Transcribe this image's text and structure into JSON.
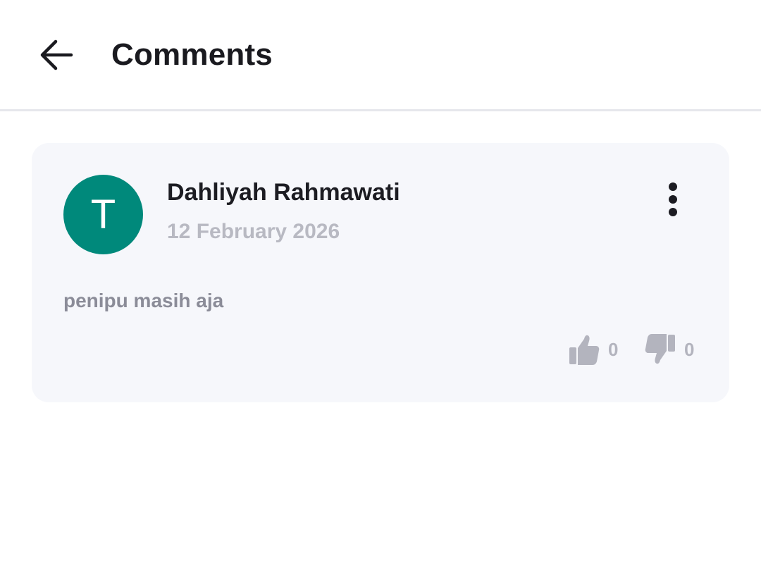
{
  "header": {
    "back_icon": "arrow-left-icon",
    "title": "Comments"
  },
  "comment": {
    "avatar_initial": "T",
    "avatar_color": "#00897b",
    "author": "Dahliyah Rahmawati",
    "date": "12 February 2026",
    "more_icon": "vertical-dots-icon",
    "text": "penipu masih aja",
    "likes": "0",
    "dislikes": "0",
    "like_icon": "thumbs-up-icon",
    "dislike_icon": "thumbs-down-icon"
  },
  "colors": {
    "title": "#1a1a1f",
    "muted": "#b3b4be",
    "card_bg": "#f6f7fb"
  }
}
